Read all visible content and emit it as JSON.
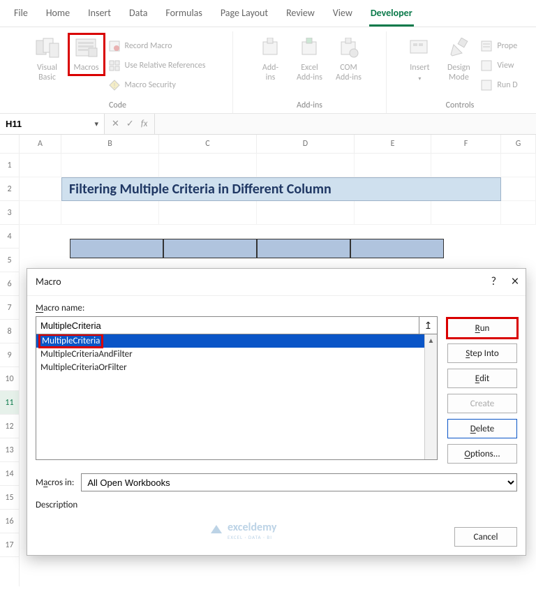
{
  "tabs": {
    "file": "File",
    "home": "Home",
    "insert": "Insert",
    "data": "Data",
    "formulas": "Formulas",
    "page_layout": "Page Layout",
    "review": "Review",
    "view": "View",
    "developer": "Developer"
  },
  "ribbon": {
    "code": {
      "visual_basic": "Visual\nBasic",
      "macros": "Macros",
      "record_macro": "Record Macro",
      "use_relative": "Use Relative References",
      "macro_security": "Macro Security",
      "group_label": "Code"
    },
    "addins": {
      "addins": "Add-\nins",
      "excel_addins": "Excel\nAdd-ins",
      "com_addins": "COM\nAdd-ins",
      "group_label": "Add-ins"
    },
    "controls": {
      "insert": "Insert",
      "design_mode": "Design\nMode",
      "properties": "Prope",
      "view_code": "View",
      "run_dialog": "Run D",
      "group_label": "Controls"
    }
  },
  "namebox": {
    "value": "H11"
  },
  "fx": {
    "cancel": "✕",
    "confirm": "✓",
    "fx": "fx"
  },
  "columns": [
    "A",
    "B",
    "C",
    "D",
    "E",
    "F",
    "G"
  ],
  "rows": [
    "1",
    "2",
    "3",
    "4",
    "5",
    "6",
    "7",
    "8",
    "9",
    "10",
    "11",
    "12",
    "13",
    "14",
    "15",
    "16",
    "17"
  ],
  "sheet": {
    "title": "Filtering Multiple Criteria in Different Column"
  },
  "dialog": {
    "title": "Macro",
    "help": "?",
    "close": "×",
    "name_label": "Macro name:",
    "name_value": "MultipleCriteria",
    "ref_icon": "↥",
    "items": [
      "MultipleCriteria",
      "MultipleCriteriaAndFilter",
      "MultipleCriteriaOrFilter"
    ],
    "buttons": {
      "run": "Run",
      "step": "Step Into",
      "edit": "Edit",
      "create": "Create",
      "delete": "Delete",
      "options": "Options...",
      "cancel": "Cancel"
    },
    "macros_in_label": "Macros in:",
    "macros_in_value": "All Open Workbooks",
    "description_label": "Description"
  },
  "watermark": {
    "brand": "exceldemy",
    "tagline": "EXCEL · DATA · BI"
  }
}
